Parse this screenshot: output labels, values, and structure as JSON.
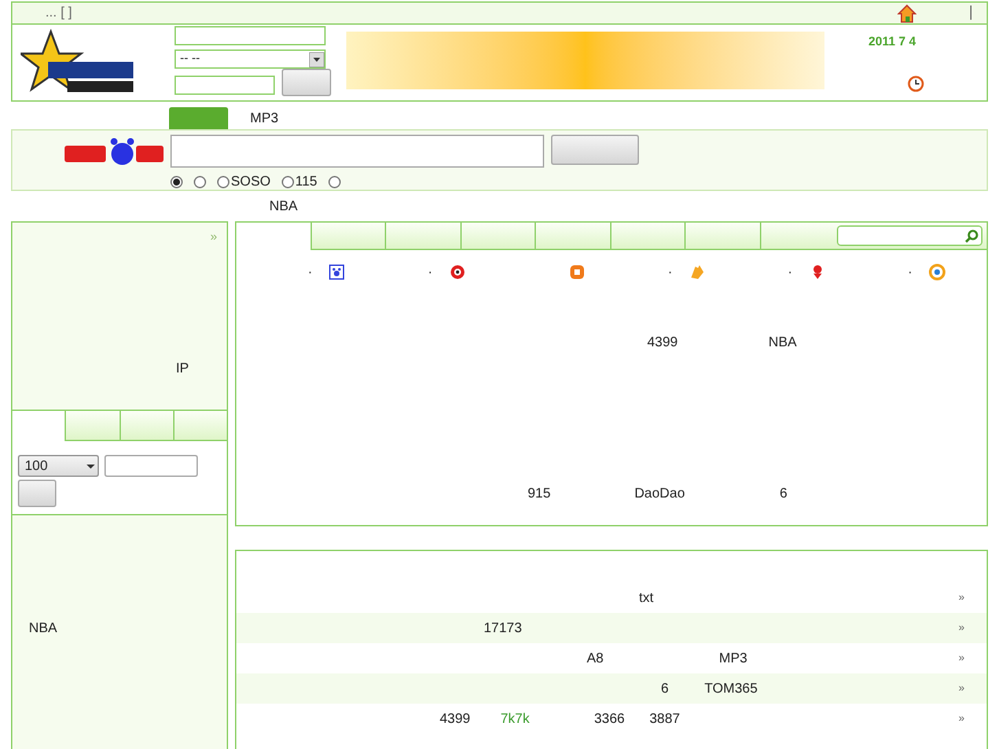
{
  "top_bar": {
    "text": "... [ ]",
    "separator": "|"
  },
  "header": {
    "login_select": "--   --",
    "date": "2011  7  4"
  },
  "search_tabs": [
    {
      "selected": true
    },
    {
      "label": "MP3",
      "selected": false
    }
  ],
  "search_engines": [
    {
      "selected": true
    },
    {
      "selected": false
    },
    {
      "label": "SOSO",
      "selected": false
    },
    {
      "label": "115",
      "selected": false
    },
    {
      "selected": false
    }
  ],
  "hot_word": "NBA",
  "left_panel": {
    "more": "»",
    "ip_label": "IP"
  },
  "left_tabs": [
    {
      "selected": true
    },
    {
      "selected": false
    },
    {
      "selected": false
    },
    {
      "selected": false
    }
  ],
  "left_form": {
    "select": "100"
  },
  "left_bottom": {
    "text": "NBA"
  },
  "main_tabs": [
    {
      "selected": true
    },
    {
      "selected": false
    },
    {
      "selected": false
    },
    {
      "selected": false
    },
    {
      "selected": false
    },
    {
      "selected": false
    },
    {
      "selected": false
    }
  ],
  "site_icons": [
    {
      "kind": "bulleted",
      "bullet": "·"
    },
    {
      "kind": "bulleted",
      "bullet": "·"
    },
    {
      "kind": "plain"
    },
    {
      "kind": "bulleted",
      "bullet": "·"
    },
    {
      "kind": "bulleted",
      "bullet": "·"
    },
    {
      "kind": "bulleted",
      "bullet": "·"
    }
  ],
  "main_lines": [
    [
      "4399",
      "NBA"
    ],
    [
      "915",
      "DaoDao",
      "6"
    ]
  ],
  "category_rows": [
    {
      "links": [
        {
          "text": "txt",
          "highlighted": false
        }
      ],
      "more": "»"
    },
    {
      "links": [
        {
          "text": "17173",
          "highlighted": false
        }
      ],
      "more": "»"
    },
    {
      "links": [
        {
          "text": "A8",
          "highlighted": false
        },
        {
          "text": "MP3",
          "highlighted": false
        }
      ],
      "more": "»"
    },
    {
      "links": [
        {
          "text": "6",
          "highlighted": false
        },
        {
          "text": "TOM365",
          "highlighted": false
        }
      ],
      "more": "»"
    },
    {
      "links": [
        {
          "text": "4399",
          "highlighted": false
        },
        {
          "text": "7k7k",
          "highlighted": true
        },
        {
          "text": "3366",
          "highlighted": false
        },
        {
          "text": "3887",
          "highlighted": false
        }
      ],
      "more": "»"
    }
  ]
}
